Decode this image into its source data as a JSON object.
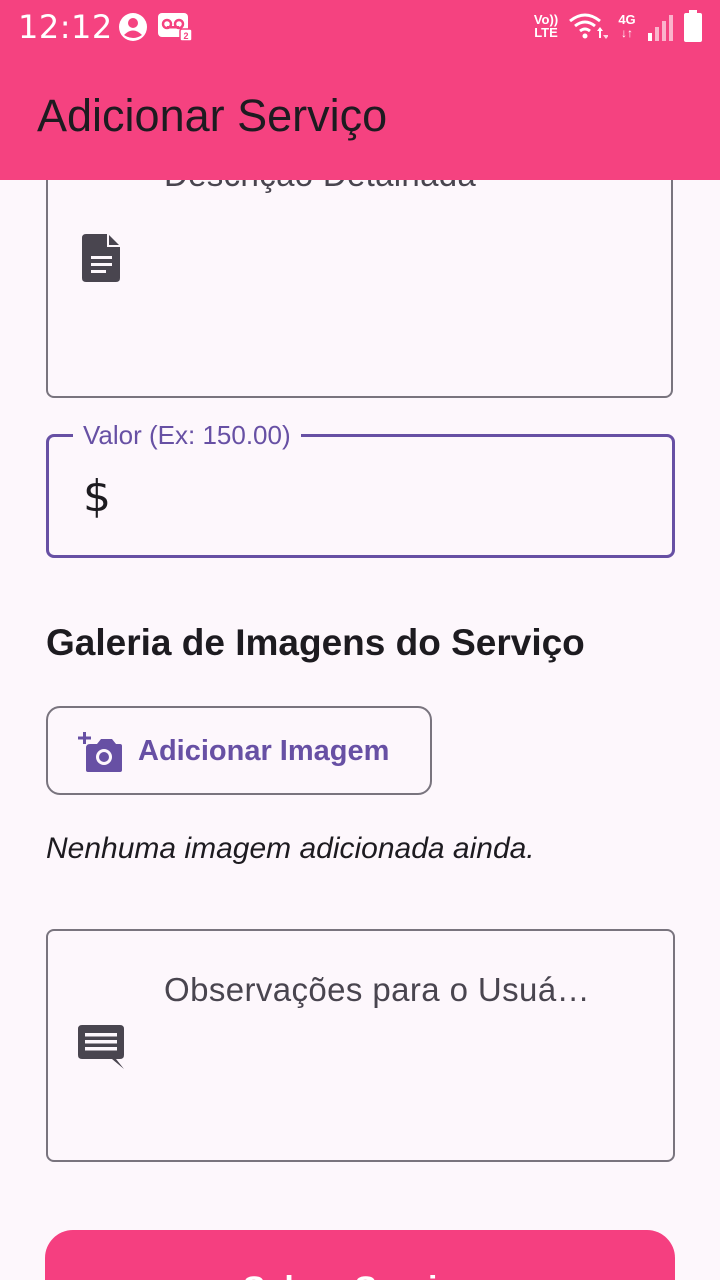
{
  "status_bar": {
    "time": "12:12",
    "volte_label": "Vo))",
    "lte_label": "LTE",
    "network_label": "4G",
    "icons": [
      "account-circle-icon",
      "voicemail-icon",
      "wifi-icon",
      "signal-icon",
      "battery-icon"
    ]
  },
  "app_bar": {
    "title": "Adicionar Serviço",
    "color": "#F54280"
  },
  "form": {
    "description_label": "Descrição Detalhada",
    "value_label": "Valor (Ex: 150.00)",
    "value_prefix": "$",
    "value_input": "",
    "gallery_title": "Galeria de Imagens do Serviço",
    "add_image_label": "Adicionar Imagem",
    "empty_gallery_text": "Nenhuma imagem adicionada ainda.",
    "notes_label": "Observações para o Usuá…",
    "save_label": "Salvar Serviço"
  },
  "colors": {
    "accent": "#6750A4",
    "primary_button": "#F53F80",
    "background": "#FDF7FC"
  }
}
